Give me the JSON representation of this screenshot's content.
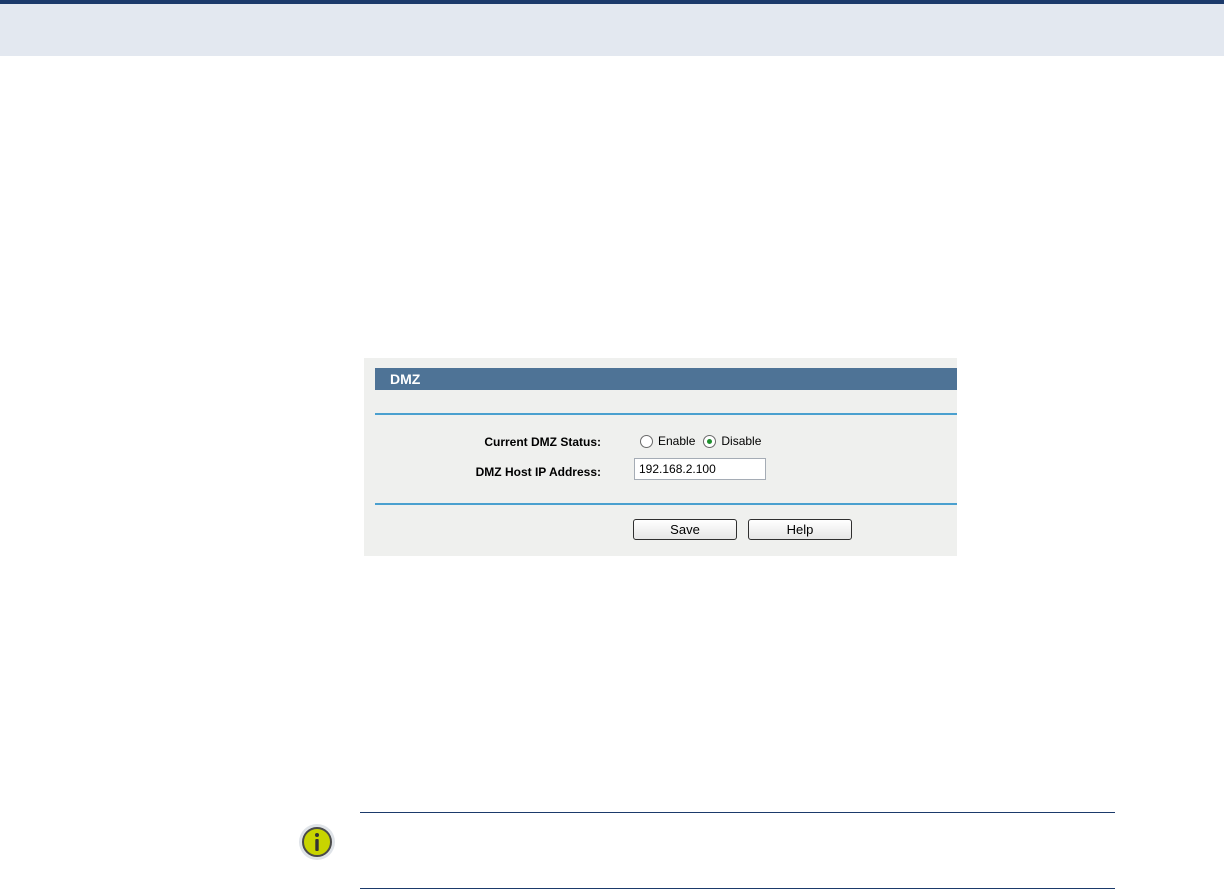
{
  "panel": {
    "title": "DMZ",
    "status_label": "Current DMZ Status:",
    "ip_label": "DMZ Host IP Address:",
    "options": [
      "Enable",
      "Disable"
    ],
    "selected_option": "Disable",
    "ip_value": "192.168.2.100",
    "save_label": "Save",
    "help_label": "Help"
  },
  "note": {
    "icon": "info-icon"
  },
  "colors": {
    "title_bar": "#4e7396",
    "rule": "#4aa0cf",
    "panel_bg": "#eff0ee",
    "header_band": "#e3e8f0",
    "accent_dark": "#1b3a6b",
    "radio_dot": "#1e8f2d"
  }
}
